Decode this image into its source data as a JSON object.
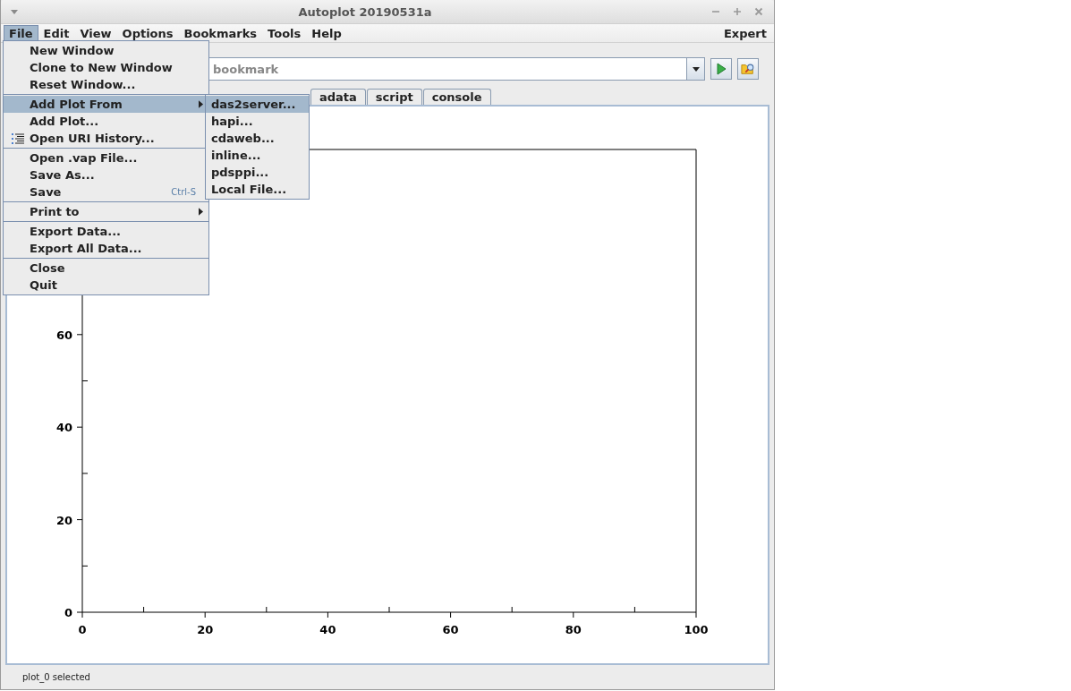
{
  "window": {
    "title": "Autoplot 20190531a"
  },
  "menu_bar": {
    "items": [
      {
        "label": "File",
        "selected": true
      },
      {
        "label": "Edit",
        "selected": false
      },
      {
        "label": "View",
        "selected": false
      },
      {
        "label": "Options",
        "selected": false
      },
      {
        "label": "Bookmarks",
        "selected": false
      },
      {
        "label": "Tools",
        "selected": false
      },
      {
        "label": "Help",
        "selected": false
      }
    ],
    "right_label": "Expert"
  },
  "address": {
    "placeholder": "bookmark"
  },
  "tabs": [
    {
      "label": "adata",
      "selected": false
    },
    {
      "label": "script",
      "selected": false
    },
    {
      "label": "console",
      "selected": false
    }
  ],
  "plot": {
    "chart_data": {
      "type": "line",
      "xlim": [
        0,
        100
      ],
      "ylim": [
        0,
        100
      ],
      "xticks": [
        0,
        20,
        40,
        60,
        80,
        100
      ],
      "yticks": [
        0,
        20,
        40,
        60
      ]
    }
  },
  "status_bar": "plot_0 selected",
  "file_menu": {
    "items": [
      {
        "kind": "item",
        "label": "New Window",
        "selected": false
      },
      {
        "kind": "item",
        "label": "Clone to New Window",
        "selected": false
      },
      {
        "kind": "item",
        "label": "Reset Window...",
        "selected": false
      },
      {
        "kind": "separator"
      },
      {
        "kind": "submenu",
        "label": "Add Plot From",
        "selected": true
      },
      {
        "kind": "item",
        "label": "Add Plot...",
        "selected": false
      },
      {
        "kind": "icon_item",
        "label": "Open URI History...",
        "selected": false
      },
      {
        "kind": "separator"
      },
      {
        "kind": "item",
        "label": "Open .vap File...",
        "selected": false
      },
      {
        "kind": "item",
        "label": "Save As...",
        "selected": false
      },
      {
        "kind": "item",
        "label": "Save",
        "shortcut": "Ctrl-S",
        "selected": false
      },
      {
        "kind": "separator"
      },
      {
        "kind": "submenu",
        "label": "Print to",
        "selected": false
      },
      {
        "kind": "separator"
      },
      {
        "kind": "item",
        "label": "Export Data...",
        "selected": false
      },
      {
        "kind": "item",
        "label": "Export All Data...",
        "selected": false
      },
      {
        "kind": "separator"
      },
      {
        "kind": "item",
        "label": "Close",
        "selected": false
      },
      {
        "kind": "item",
        "label": "Quit",
        "selected": false
      }
    ]
  },
  "submenu": {
    "items": [
      {
        "label": "das2server...",
        "selected": true
      },
      {
        "label": "hapi...",
        "selected": false
      },
      {
        "label": "cdaweb...",
        "selected": false
      },
      {
        "label": "inline...",
        "selected": false
      },
      {
        "label": "pdsppi...",
        "selected": false
      },
      {
        "label": "Local File...",
        "selected": false
      }
    ]
  }
}
